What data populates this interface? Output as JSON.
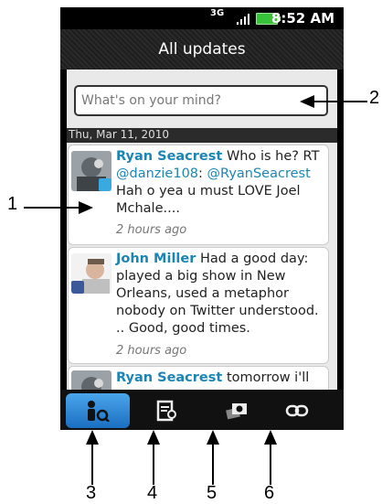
{
  "status_bar": {
    "network": "3G",
    "time": "8:52 AM",
    "battery_color": "#38c23a"
  },
  "header": {
    "title": "All updates"
  },
  "composer": {
    "placeholder": "What's on your mind?"
  },
  "feed": {
    "date_header": "Thu, Mar 11, 2010",
    "posts": [
      {
        "author": "Ryan Seacrest",
        "text_before": "Who is he? RT",
        "mention1": "@danzie108",
        "sep": ":",
        "mention2": "@RyanSeacrest",
        "text_after": "Hah o yea u must LOVE Joel Mchale....",
        "time": "2 hours ago",
        "source_icon": "twitter-icon"
      },
      {
        "author": "John Miller",
        "text": "Had a good day: played a big show in New Orleans, used a metaphor nobody on Twitter understood. .. Good, good times.",
        "time": "2 hours ago",
        "source_icon": "facebook-icon"
      },
      {
        "author": "Ryan Seacrest",
        "text": "tomorrow i'll",
        "source_icon": "twitter-icon"
      }
    ]
  },
  "tabs": [
    {
      "name": "people-tab",
      "icon": "people-icon",
      "active": true
    },
    {
      "name": "updates-tab",
      "icon": "updates-icon",
      "active": false
    },
    {
      "name": "photos-tab",
      "icon": "photos-icon",
      "active": false
    },
    {
      "name": "links-tab",
      "icon": "link-icon",
      "active": false
    }
  ],
  "callouts": {
    "c1": "1",
    "c2": "2",
    "c3": "3",
    "c4": "4",
    "c5": "5",
    "c6": "6"
  },
  "colors": {
    "accent": "#1b86b6",
    "tab_active": "#2d8ad8"
  }
}
